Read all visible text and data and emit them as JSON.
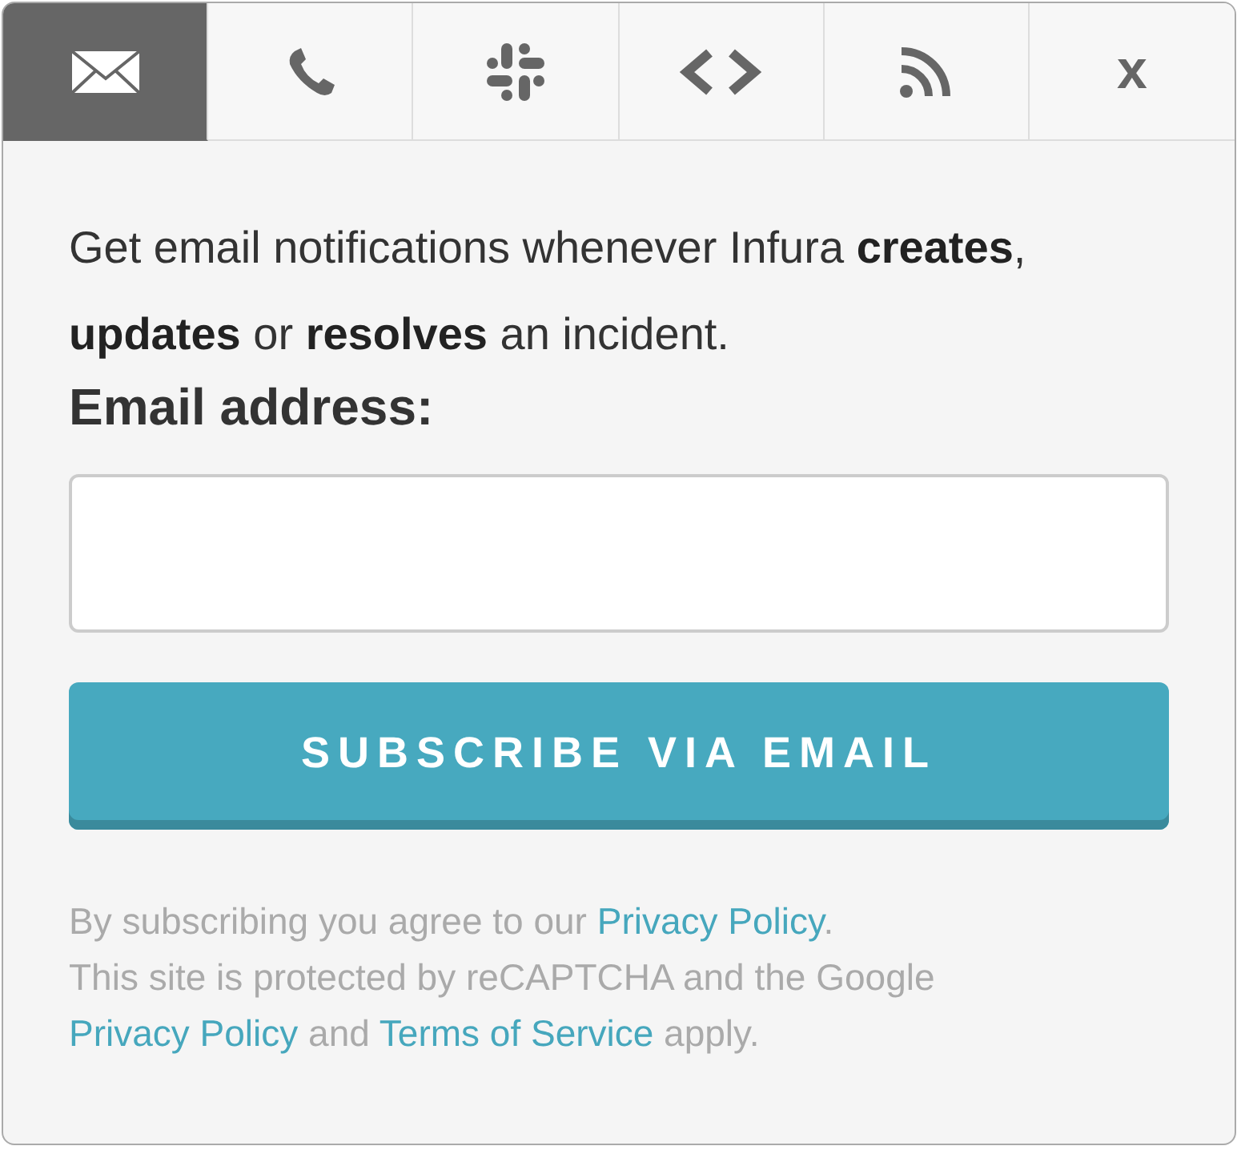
{
  "tabs": [
    {
      "kind": "email",
      "selected": true
    },
    {
      "kind": "phone",
      "selected": false
    },
    {
      "kind": "slack",
      "selected": false
    },
    {
      "kind": "code",
      "selected": false
    },
    {
      "kind": "rss",
      "selected": false
    },
    {
      "kind": "close",
      "label": "x",
      "selected": false
    }
  ],
  "intro": "Get email notifications whenever Infura **creates**, **updates** or **resolves** an incident.",
  "field_label": "Email address:",
  "subscribe_button": "SUBSCRIBE VIA EMAIL",
  "disclaimer": [
    [
      {
        "kind": "text",
        "text": "By subscribing you agree to our "
      },
      {
        "kind": "link",
        "text": "Privacy Policy"
      },
      {
        "kind": "text",
        "text": "."
      }
    ],
    [
      {
        "kind": "text",
        "text": "This site is protected by reCAPTCHA and the Google"
      }
    ],
    [
      {
        "kind": "link",
        "text": "Privacy Policy"
      },
      {
        "kind": "text",
        "text": " and "
      },
      {
        "kind": "link",
        "text": "Terms of Service"
      },
      {
        "kind": "text",
        "text": " apply."
      }
    ]
  ]
}
